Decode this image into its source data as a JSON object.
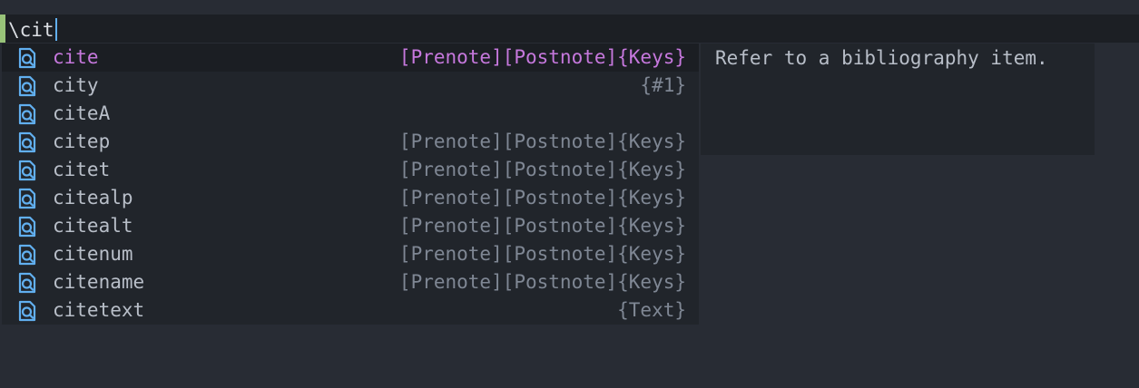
{
  "editor": {
    "line_text": "\\cit"
  },
  "completion": {
    "icon_name": "search-file-icon",
    "accent_color": "#c678dd",
    "items": [
      {
        "label": "cite",
        "detail": "[Prenote][Postnote]{Keys}",
        "selected": true
      },
      {
        "label": "city",
        "detail": "{#1}"
      },
      {
        "label": "citeA",
        "detail": ""
      },
      {
        "label": "citep",
        "detail": "[Prenote][Postnote]{Keys}"
      },
      {
        "label": "citet",
        "detail": "[Prenote][Postnote]{Keys}"
      },
      {
        "label": "citealp",
        "detail": "[Prenote][Postnote]{Keys}"
      },
      {
        "label": "citealt",
        "detail": "[Prenote][Postnote]{Keys}"
      },
      {
        "label": "citenum",
        "detail": "[Prenote][Postnote]{Keys}"
      },
      {
        "label": "citename",
        "detail": "[Prenote][Postnote]{Keys}"
      },
      {
        "label": "citetext",
        "detail": "{Text}"
      }
    ]
  },
  "documentation": {
    "text": "Refer to a bibliography item."
  }
}
